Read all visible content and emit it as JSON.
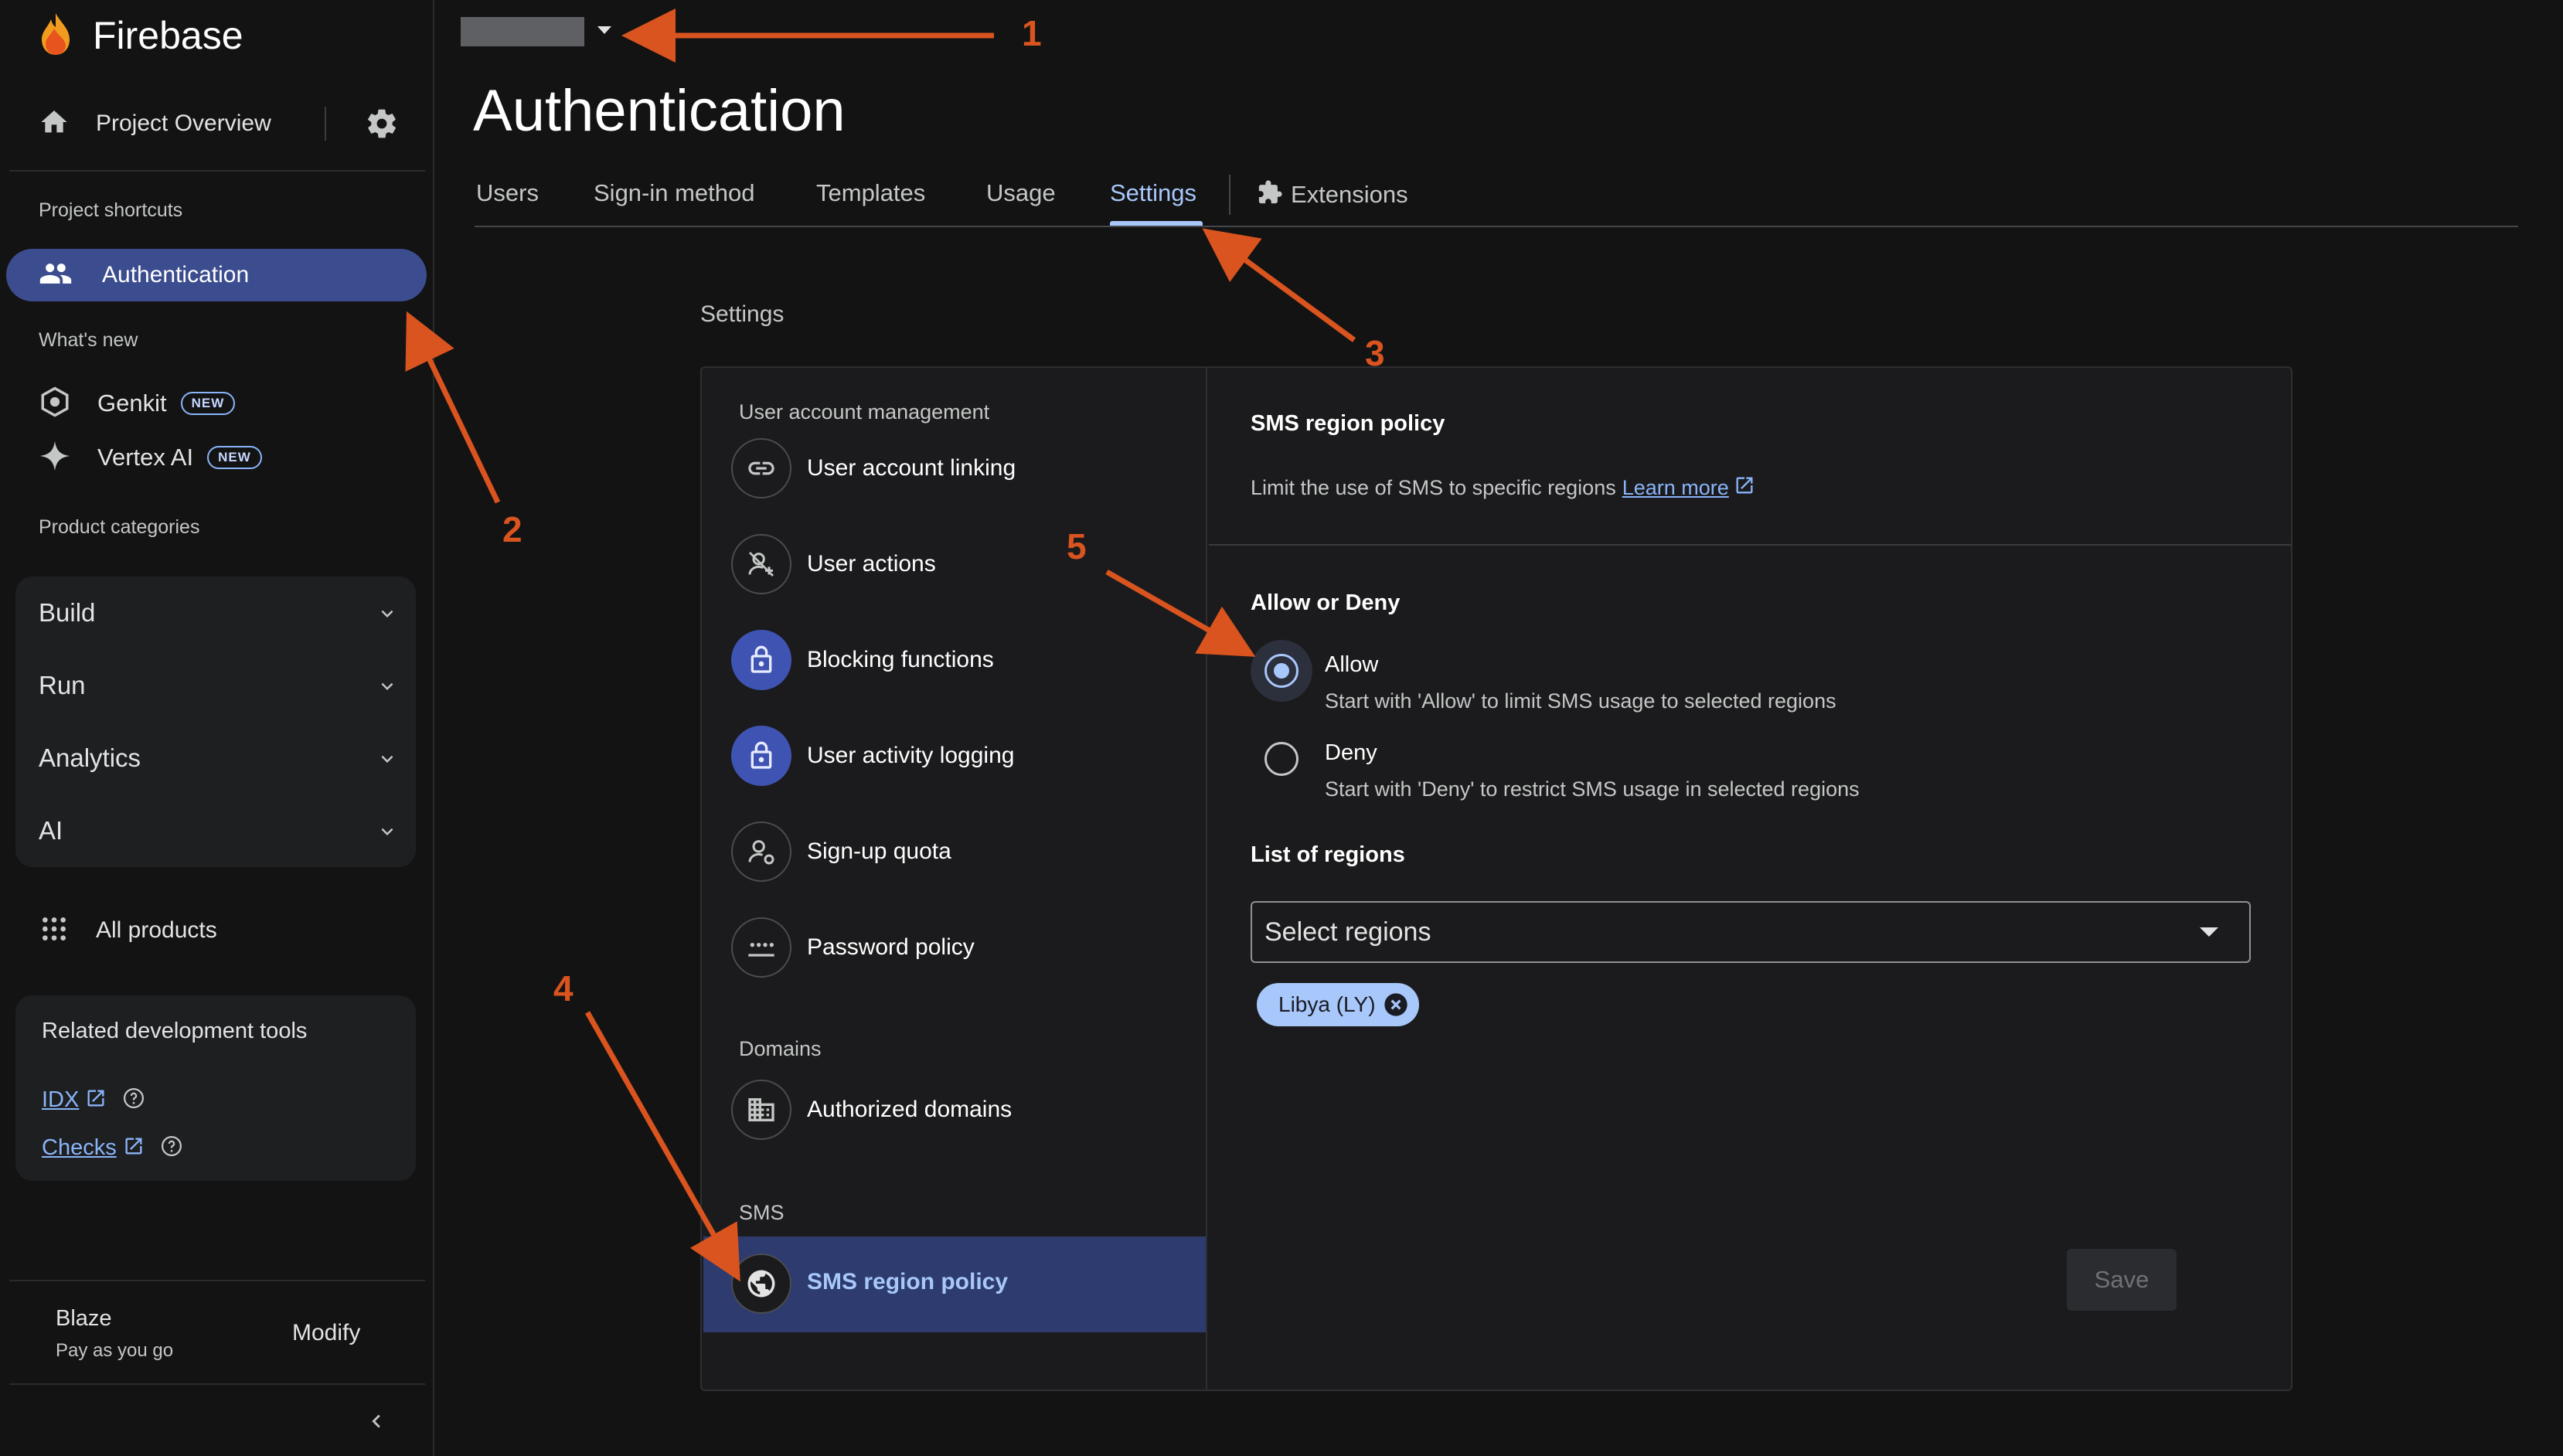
{
  "app": {
    "name": "Firebase"
  },
  "sidebar": {
    "project_overview": "Project Overview",
    "shortcuts_caption": "Project shortcuts",
    "active_item": "Authentication",
    "whats_new_caption": "What's new",
    "new_items": [
      {
        "label": "Genkit",
        "badge": "NEW",
        "icon": "genkit-icon"
      },
      {
        "label": "Vertex AI",
        "badge": "NEW",
        "icon": "sparkle-icon"
      }
    ],
    "categories_caption": "Product categories",
    "categories": [
      "Build",
      "Run",
      "Analytics",
      "AI"
    ],
    "all_products": "All products",
    "tools": {
      "title": "Related development tools",
      "links": [
        "IDX",
        "Checks"
      ]
    },
    "plan": {
      "name": "Blaze",
      "subtitle": "Pay as you go",
      "action": "Modify"
    }
  },
  "header": {
    "page_title": "Authentication",
    "tabs": [
      "Users",
      "Sign-in method",
      "Templates",
      "Usage",
      "Settings"
    ],
    "active_tab": "Settings",
    "extensions_tab": "Extensions"
  },
  "settings": {
    "caption": "Settings",
    "groups": [
      {
        "caption": "User account management",
        "items": [
          {
            "label": "User account linking",
            "icon": "link-icon"
          },
          {
            "label": "User actions",
            "icon": "user-actions-icon"
          },
          {
            "label": "Blocking functions",
            "icon": "lock-icon"
          },
          {
            "label": "User activity logging",
            "icon": "lock-icon"
          },
          {
            "label": "Sign-up quota",
            "icon": "user-settings-icon"
          },
          {
            "label": "Password policy",
            "icon": "password-icon"
          }
        ]
      },
      {
        "caption": "Domains",
        "items": [
          {
            "label": "Authorized domains",
            "icon": "building-icon"
          }
        ]
      },
      {
        "caption": "SMS",
        "items": [
          {
            "label": "SMS region policy",
            "icon": "globe-icon"
          }
        ]
      }
    ],
    "active_item": "SMS region policy"
  },
  "sms_policy": {
    "title": "SMS region policy",
    "description": "Limit the use of SMS to specific regions",
    "learn_more": "Learn more",
    "allow_deny_title": "Allow or Deny",
    "options": [
      {
        "label": "Allow",
        "help": "Start with 'Allow' to limit SMS usage to selected regions",
        "selected": true
      },
      {
        "label": "Deny",
        "help": "Start with 'Deny' to restrict SMS usage in selected regions",
        "selected": false
      }
    ],
    "regions_title": "List of regions",
    "select_placeholder": "Select regions",
    "selected_regions": [
      "Libya (LY)"
    ],
    "save_label": "Save"
  },
  "annotations": [
    "1",
    "2",
    "3",
    "4",
    "5"
  ],
  "colors": {
    "accent": "#a8c7fa",
    "active_nav": "#3c4d8f",
    "annotation": "#d9541e",
    "background": "#131314"
  }
}
